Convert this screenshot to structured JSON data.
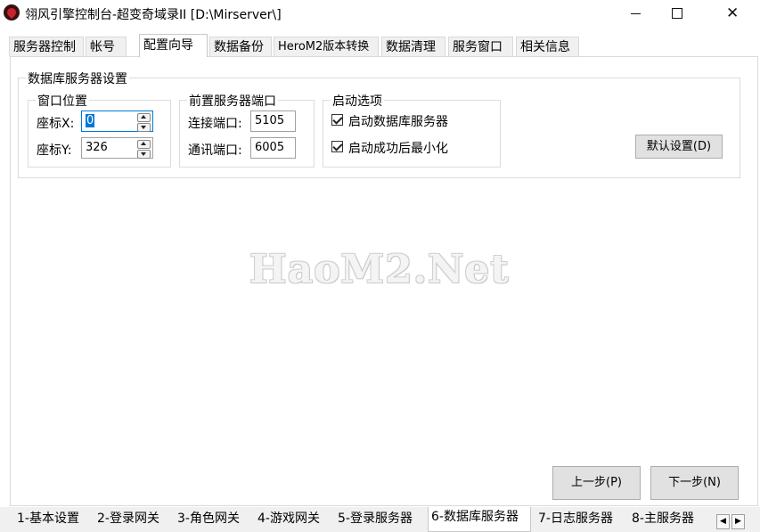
{
  "window": {
    "title": "翎风引擎控制台-超变奇域录II [D:\\Mirserver\\]",
    "controls": {
      "minimize": "",
      "maximize": "",
      "close": "✕"
    }
  },
  "top_tabs": [
    "服务器控制",
    "帐号",
    "配置向导",
    "数据备份",
    "HeroM2版本转换",
    "数据清理",
    "服务窗口",
    "相关信息"
  ],
  "active_top_tab": "配置向导",
  "db_settings": {
    "title": "数据库服务器设置",
    "window_pos": {
      "title": "窗口位置",
      "x_label": "座标X:",
      "x_value": "0",
      "y_label": "座标Y:",
      "y_value": "326"
    },
    "front_ports": {
      "title": "前置服务器端口",
      "connect_label": "连接端口:",
      "connect_value": "5105",
      "comm_label": "通讯端口:",
      "comm_value": "6005"
    },
    "startup": {
      "title": "启动选项",
      "option1": "启动数据库服务器",
      "option1_checked": true,
      "option2": "启动成功后最小化",
      "option2_checked": true
    },
    "default_button": "默认设置(D)"
  },
  "watermark": "HaoM2.Net",
  "nav": {
    "prev": "上一步(P)",
    "next": "下一步(N)"
  },
  "bottom_tabs": [
    "1-基本设置",
    "2-登录网关",
    "3-角色网关",
    "4-游戏网关",
    "5-登录服务器",
    "6-数据库服务器",
    "7-日志服务器",
    "8-主服务器"
  ],
  "active_bottom_tab": "6-数据库服务器",
  "scroll": {
    "left": "◀",
    "right": "▶"
  }
}
